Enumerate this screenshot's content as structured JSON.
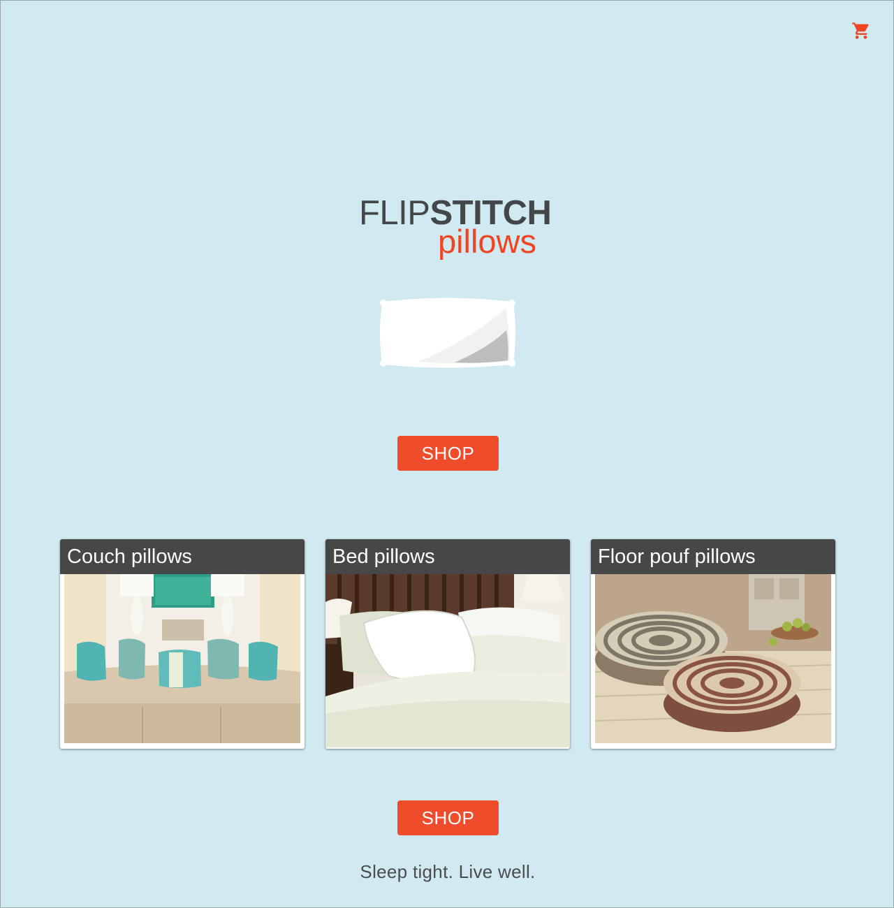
{
  "header": {
    "cart_icon": "shopping-cart-icon",
    "accent_color": "#ef4523"
  },
  "brand": {
    "name_light": "FLIP",
    "name_bold": "STITCH",
    "subtitle": "pillows",
    "text_color": "#444749",
    "accent_color": "#ef4523"
  },
  "hero": {
    "illustration": "pillow-icon",
    "shop_label": "SHOP"
  },
  "categories": [
    {
      "title": "Couch pillows",
      "image": "couch-with-teal-pillows-photo"
    },
    {
      "title": "Bed pillows",
      "image": "bed-with-white-pillows-photo"
    },
    {
      "title": "Floor pouf pillows",
      "image": "woven-floor-poufs-photo"
    }
  ],
  "footer": {
    "shop_label": "SHOP",
    "tagline": "Sleep tight. Live well."
  },
  "colors": {
    "background": "#d1e9f1",
    "button": "#ef4c2c",
    "card_header": "#474747"
  }
}
